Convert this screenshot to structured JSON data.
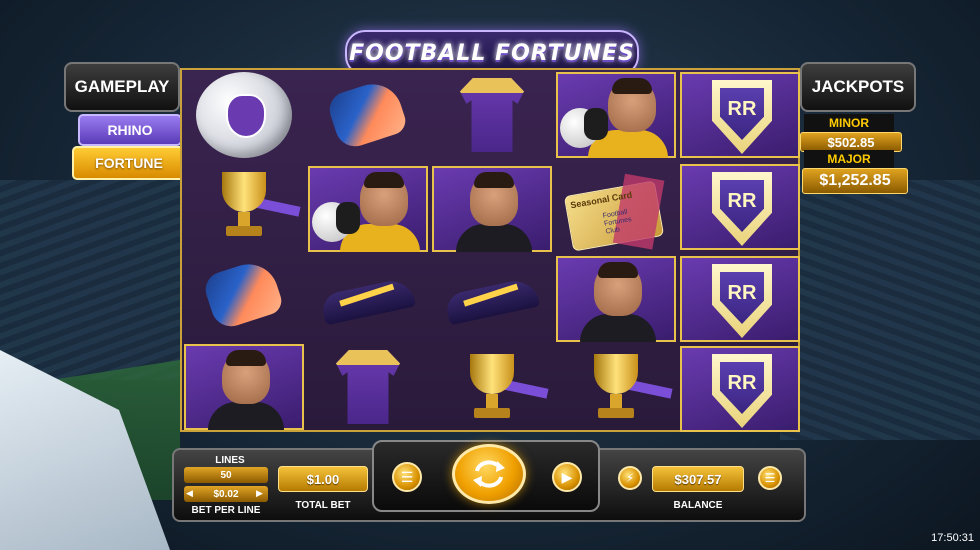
{
  "game": {
    "title": "FOOTBALL FORTUNES"
  },
  "gameplay": {
    "heading": "GAMEPLAY",
    "modes": [
      {
        "label": "RHINO",
        "selected": false
      },
      {
        "label": "FORTUNE",
        "selected": true
      }
    ]
  },
  "jackpots": {
    "heading": "JACKPOTS",
    "minor": {
      "label": "MINOR",
      "value": "$502.85"
    },
    "major": {
      "label": "MAJOR",
      "value": "$1,252.85"
    }
  },
  "reels": [
    [
      "ball-symbol",
      "trophy-symbol",
      "glove-symbol",
      "referee-symbol"
    ],
    [
      "glove-symbol",
      "goalkeeper-symbol",
      "boot-symbol",
      "shirt-symbol"
    ],
    [
      "shirt-symbol",
      "referee-symbol",
      "boot-symbol",
      "trophy-symbol"
    ],
    [
      "goalkeeper-symbol",
      "card-symbol",
      "referee-symbol",
      "trophy-symbol"
    ],
    [
      "shield-symbol",
      "shield-symbol",
      "shield-symbol",
      "shield-symbol"
    ]
  ],
  "card_symbol": {
    "title": "Seasonal Card",
    "subtitle": "Football Fortunes Club"
  },
  "shield_symbol": {
    "monogram": "RR"
  },
  "controls": {
    "lines_label": "LINES",
    "lines_value": "50",
    "bet_per_line_value": "$0.02",
    "bet_per_line_label": "BET PER LINE",
    "total_bet_value": "$1.00",
    "total_bet_label": "TOTAL BET",
    "balance_value": "$307.57",
    "balance_label": "BALANCE",
    "decrease_symbol": "◀",
    "increase_symbol": "▶",
    "autoplay_icon": "autoplay-icon",
    "menu_icon": "menu-icon",
    "turbo_icon": "lightning-icon",
    "info_icon": "info-icon",
    "spin_icon": "spin-arrows-icon"
  },
  "clock": "17:50:31",
  "colors": {
    "gold": "#f5c23a",
    "purple": "#6a3bb0",
    "frame": "#c9a23a"
  }
}
